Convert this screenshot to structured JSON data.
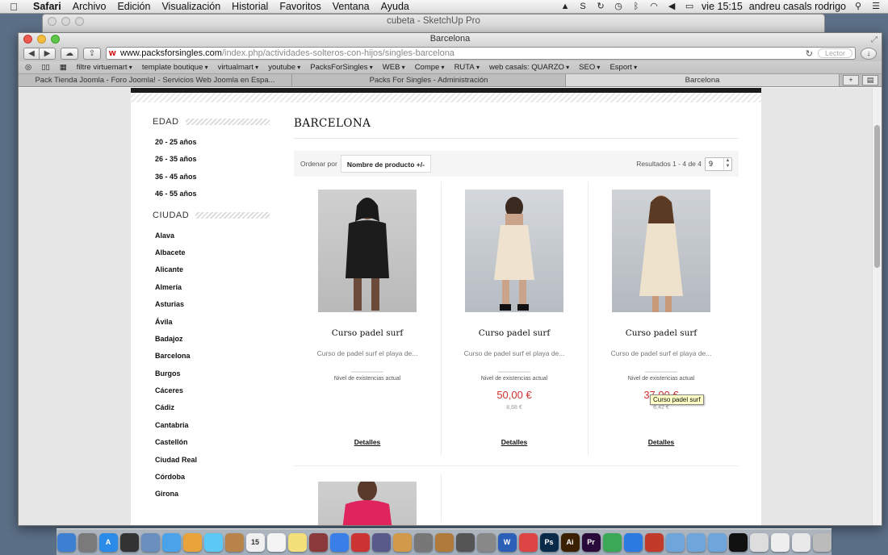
{
  "menubar": {
    "apple_glyph": "",
    "app": "Safari",
    "items": [
      "Archivo",
      "Edición",
      "Visualización",
      "Historial",
      "Favoritos",
      "Ventana",
      "Ayuda"
    ],
    "clock": "vie 15:15",
    "user": "andreu casals rodrigo",
    "status_icons": [
      "drive-icon",
      "skype-icon",
      "sync-icon",
      "time-machine-icon",
      "bluetooth-icon",
      "wifi-icon",
      "volume-icon",
      "battery-icon"
    ]
  },
  "background_window": {
    "title": "cubeta - SketchUp Pro"
  },
  "browser": {
    "title": "Barcelona",
    "url_domain": "www.packsforsingles.com",
    "url_path": "/index.php/actividades-solteros-con-hijos/singles-barcelona",
    "reader_label": "Lector",
    "bookmarks": [
      {
        "label": "filtre virtuemart",
        "menu": true
      },
      {
        "label": "template boutique",
        "menu": true
      },
      {
        "label": "virtualmart",
        "menu": true
      },
      {
        "label": "youtube",
        "menu": true
      },
      {
        "label": "PacksForSingles",
        "menu": true
      },
      {
        "label": "WEB",
        "menu": true
      },
      {
        "label": "Compe",
        "menu": true
      },
      {
        "label": "RUTA",
        "menu": true
      },
      {
        "label": "web casals: QUARZO",
        "menu": true
      },
      {
        "label": "SEO",
        "menu": true
      },
      {
        "label": "Esport",
        "menu": true
      }
    ],
    "tabs": [
      {
        "label": "Pack Tienda Joomla - Foro Joomla! - Servicios Web Joomla en Espa...",
        "active": false
      },
      {
        "label": "Packs For Singles - Administración",
        "active": false
      },
      {
        "label": "Barcelona",
        "active": true
      }
    ],
    "new_tab_label": "+"
  },
  "sidebar": {
    "age_heading": "EDAD",
    "ages": [
      "20 - 25 años",
      "26 - 35 años",
      "36 - 45 años",
      "46 - 55 años"
    ],
    "city_heading": "CIUDAD",
    "cities": [
      "Alava",
      "Albacete",
      "Alicante",
      "Almería",
      "Asturias",
      "Ávila",
      "Badajoz",
      "Barcelona",
      "Burgos",
      "Cáceres",
      "Cádiz",
      "Cantabria",
      "Castellón",
      "Ciudad Real",
      "Córdoba",
      "Girona"
    ]
  },
  "main": {
    "category_title": "BARCELONA",
    "order_label": "Ordenar por",
    "order_value": "Nombre de producto +/-",
    "results_label": "Resultados 1 - 4 de 4",
    "per_page": "9"
  },
  "products": [
    {
      "name": "Curso padel surf",
      "desc": "Curso de padel surf el playa de...",
      "stock_label": "Nivel de existencias actual",
      "price": "",
      "tax": "",
      "details": "Detalles",
      "dress_color": "#1c1c1c"
    },
    {
      "name": "Curso padel surf",
      "desc": "Curso de padel surf el playa de...",
      "stock_label": "Nivel de existencias actual",
      "price": "50,00 €",
      "tax": "8,68 €",
      "details": "Detalles",
      "dress_color": "#efe3cf"
    },
    {
      "name": "Curso padel surf",
      "desc": "Curso de padel surf el playa de...",
      "stock_label": "Nivel de existencias actual",
      "price": "37,00 €",
      "tax": "6,42 €",
      "details": "Detalles",
      "dress_color": "#efe2cc"
    }
  ],
  "tooltip": "Curso padel surf",
  "dock_apps": [
    {
      "name": "finder",
      "color": "#3d7fd1",
      "glyph": ""
    },
    {
      "name": "launchpad",
      "color": "#7a7a7a",
      "glyph": ""
    },
    {
      "name": "app-store",
      "color": "#2a8ce8",
      "glyph": "A"
    },
    {
      "name": "dashboard",
      "color": "#333333",
      "glyph": ""
    },
    {
      "name": "preview",
      "color": "#6a8fbf",
      "glyph": ""
    },
    {
      "name": "safari",
      "color": "#4aa3e8",
      "glyph": ""
    },
    {
      "name": "chrome",
      "color": "#e8a33a",
      "glyph": ""
    },
    {
      "name": "messages",
      "color": "#5cc8f5",
      "glyph": ""
    },
    {
      "name": "contacts",
      "color": "#b8844a",
      "glyph": ""
    },
    {
      "name": "calendar",
      "color": "#f0f0f0",
      "glyph": "15"
    },
    {
      "name": "reminders",
      "color": "#f4f4f4",
      "glyph": ""
    },
    {
      "name": "notes",
      "color": "#f3e07a",
      "glyph": ""
    },
    {
      "name": "photo-booth",
      "color": "#8a3a3a",
      "glyph": ""
    },
    {
      "name": "itunes",
      "color": "#3a7fe8",
      "glyph": ""
    },
    {
      "name": "photo-app",
      "color": "#c33",
      "glyph": ""
    },
    {
      "name": "imovie",
      "color": "#5a5a8a",
      "glyph": ""
    },
    {
      "name": "iphoto",
      "color": "#d09a4a",
      "glyph": ""
    },
    {
      "name": "tools",
      "color": "#777777",
      "glyph": ""
    },
    {
      "name": "garageband",
      "color": "#b07a3a",
      "glyph": ""
    },
    {
      "name": "time-machine",
      "color": "#555555",
      "glyph": ""
    },
    {
      "name": "system-preferences",
      "color": "#888888",
      "glyph": ""
    },
    {
      "name": "word",
      "color": "#2b5fb8",
      "glyph": "W"
    },
    {
      "name": "stickies",
      "color": "#d44",
      "glyph": ""
    },
    {
      "name": "photoshop",
      "color": "#0a2a4a",
      "glyph": "Ps"
    },
    {
      "name": "illustrator",
      "color": "#3a1f00",
      "glyph": "Ai"
    },
    {
      "name": "premiere",
      "color": "#2a0a3a",
      "glyph": "Pr"
    },
    {
      "name": "google-drive",
      "color": "#3aa857",
      "glyph": ""
    },
    {
      "name": "dropbox",
      "color": "#2a7ae2",
      "glyph": ""
    },
    {
      "name": "sketchup",
      "color": "#c23a2a",
      "glyph": ""
    },
    {
      "name": "folder-1",
      "color": "#6ea6dc",
      "glyph": ""
    },
    {
      "name": "folder-2",
      "color": "#6ea6dc",
      "glyph": ""
    },
    {
      "name": "folder-3",
      "color": "#6ea6dc",
      "glyph": ""
    },
    {
      "name": "display",
      "color": "#111111",
      "glyph": ""
    },
    {
      "name": "document-1",
      "color": "#dddddd",
      "glyph": ""
    },
    {
      "name": "document-2",
      "color": "#eeeeee",
      "glyph": ""
    },
    {
      "name": "document-3",
      "color": "#e8e8e8",
      "glyph": ""
    },
    {
      "name": "trash",
      "color": "#bbbbbb",
      "glyph": ""
    }
  ]
}
